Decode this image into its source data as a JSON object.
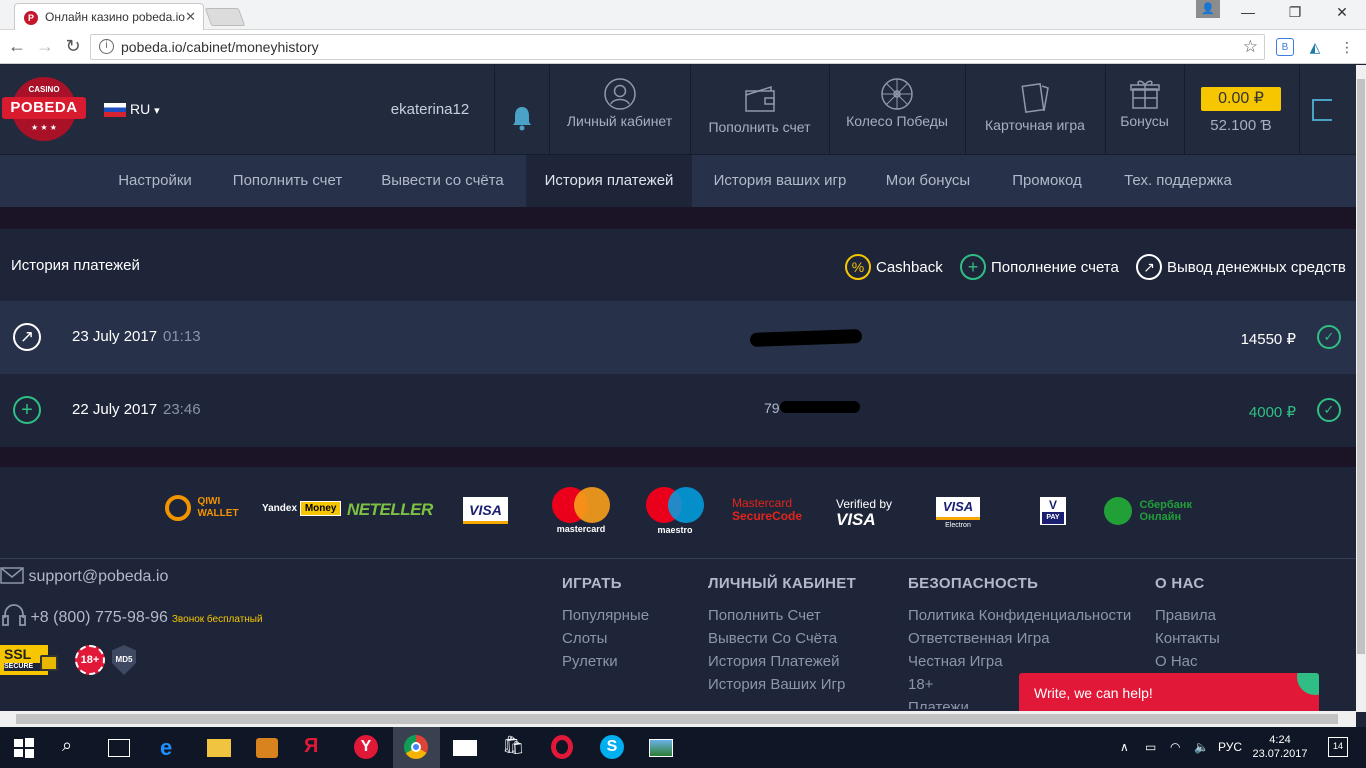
{
  "browser": {
    "tab_title": "Онлайн казино pobeda.io",
    "favicon_letter": "P",
    "url": "pobeda.io/cabinet/moneyhistory"
  },
  "header": {
    "logo_top": "CASINO",
    "logo_name": "POBEDA",
    "logo_stars": "★ ★ ★",
    "language": "RU",
    "username": "ekaterina12",
    "items": [
      {
        "label": "Личный кабинет",
        "icon": "user-icon"
      },
      {
        "label": "Пополнить счет",
        "icon": "wallet-icon"
      },
      {
        "label": "Колесо Победы",
        "icon": "wheel-icon"
      },
      {
        "label": "Карточная игра",
        "icon": "cards-icon"
      },
      {
        "label": "Бонусы",
        "icon": "gift-icon"
      }
    ],
    "balance": "0.00 ₽",
    "bonus_balance": "52.100 Ɓ"
  },
  "subnav": {
    "items": [
      "Настройки",
      "Пополнить счет",
      "Вывести со счёта",
      "История платежей",
      "История ваших игр",
      "Мои бонусы",
      "Промокод",
      "Тех. поддержка"
    ],
    "active": "История платежей"
  },
  "history": {
    "title": "История платежей",
    "legend": {
      "cashback": "Cashback",
      "deposit": "Пополнение счета",
      "withdraw": "Вывод денежных средств"
    },
    "rows": [
      {
        "type": "withdraw",
        "date": "23 July 2017",
        "time": "01:13",
        "account_prefix": "",
        "amount": "14550 ₽",
        "amount_color": "#ffffff"
      },
      {
        "type": "deposit",
        "date": "22 July 2017",
        "time": "23:46",
        "account_prefix": "79",
        "amount": "4000 ₽",
        "amount_color": "#2fbf84"
      }
    ]
  },
  "payments": {
    "qiwi_1": "QIWI",
    "qiwi_2": "WALLET",
    "yandex_1": "Yandex",
    "yandex_2": "Money",
    "neteller": "NETELLER",
    "visa": "VISA",
    "mastercard": "mastercard",
    "maestro": "maestro",
    "mc_secure_1": "Mastercard",
    "mc_secure_2": "SecureCode",
    "verified_1": "Verified by",
    "verified_2": "VISA",
    "visa_electron_1": "VISA",
    "visa_electron_2": "Electron",
    "vpay_1": "V",
    "vpay_2": "PAY",
    "sber_1": "Сбербанк",
    "sber_2": "Онлайн"
  },
  "footer": {
    "email": "support@pobeda.io",
    "phone": "+8 (800) 775-98-96",
    "free_call": "Звонок бесплатный",
    "ssl_1": "SSL",
    "ssl_2": "SECURE",
    "age": "18+",
    "md5": "MD5",
    "columns": [
      {
        "title": "ИГРАТЬ",
        "links": [
          "Популярные",
          "Слоты",
          "Рулетки"
        ]
      },
      {
        "title": "ЛИЧНЫЙ КАБИНЕТ",
        "links": [
          "Пополнить Счет",
          "Вывести Со Счёта",
          "История Платежей",
          "История Ваших Игр"
        ]
      },
      {
        "title": "БЕЗОПАСНОСТЬ",
        "links": [
          "Политика Конфиденциальности",
          "Ответственная Игра",
          "Честная Игра",
          "18+",
          "Платежи"
        ]
      },
      {
        "title": "О НАС",
        "links": [
          "Правила",
          "Контакты",
          "О Нас"
        ]
      }
    ],
    "chat_label": "Write, we can help!"
  },
  "taskbar": {
    "lang": "РУС",
    "time": "4:24",
    "date": "23.07.2017",
    "notifications": "14"
  },
  "colors": {
    "accent_yellow": "#f6c700",
    "success_green": "#2fbf84",
    "brand_red": "#d91b2f",
    "chat_red": "#e11837"
  }
}
